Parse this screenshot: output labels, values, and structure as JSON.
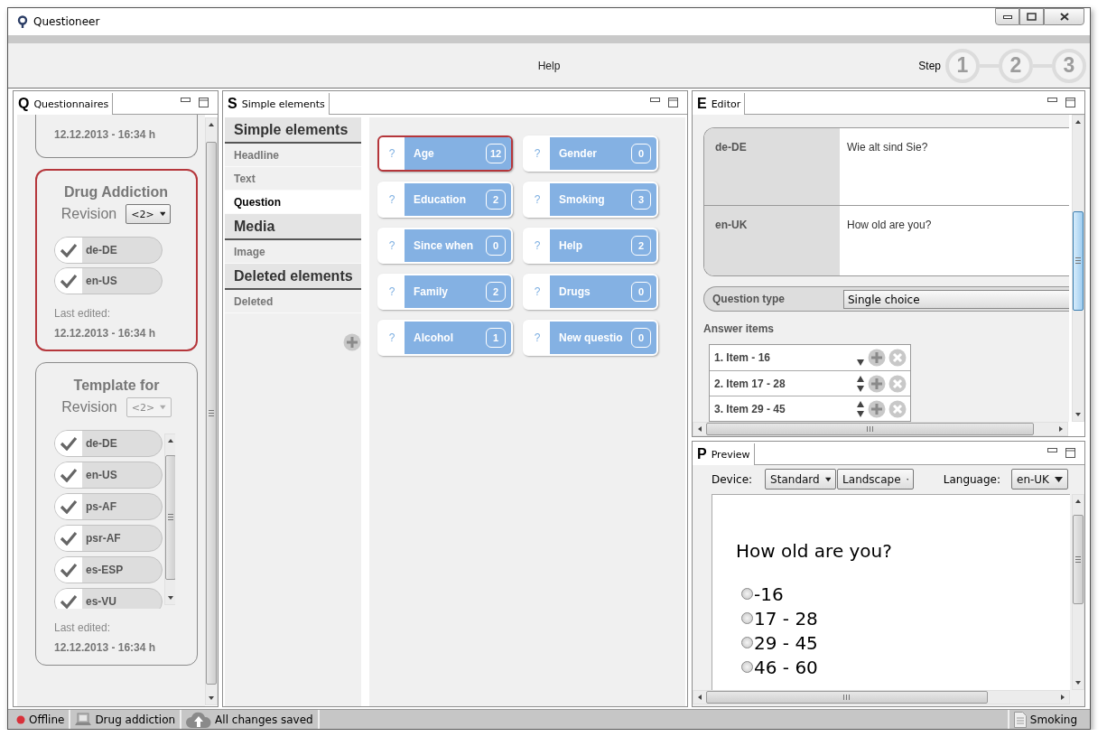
{
  "window": {
    "title": "Questioneer"
  },
  "toolbar": {
    "help": "Help",
    "step_label": "Step",
    "steps": [
      "1",
      "2",
      "3"
    ]
  },
  "questionnaires": {
    "tab_letter": "Q",
    "tab": "Questionnaires",
    "cards": [
      {
        "kind": "partial",
        "selected": false,
        "last_edited_date": "12.12.2013 - 16:34 h"
      },
      {
        "kind": "full",
        "selected": true,
        "title": "Drug Addiction",
        "revision_label": "Revision",
        "revision": "<2>",
        "revision_disabled": false,
        "languages": [
          {
            "code": "de-DE",
            "checked": true
          },
          {
            "code": "en-US",
            "checked": true
          }
        ],
        "last_edited_label": "Last edited:",
        "last_edited_date": "12.12.2013 - 16:34 h"
      },
      {
        "kind": "full",
        "selected": false,
        "title": "Template for",
        "revision_label": "Revision",
        "revision": "<2>",
        "revision_disabled": true,
        "languages": [
          {
            "code": "de-DE",
            "checked": true
          },
          {
            "code": "en-US",
            "checked": true
          },
          {
            "code": "ps-AF",
            "checked": true
          },
          {
            "code": "psr-AF",
            "checked": true
          },
          {
            "code": "es-ESP",
            "checked": true
          },
          {
            "code": "es-VU",
            "checked": true
          }
        ],
        "last_edited_label": "Last edited:",
        "last_edited_date": "12.12.2013 - 16:34 h"
      }
    ]
  },
  "elements": {
    "tab_letter": "S",
    "tab": "Simple elements",
    "categories": [
      {
        "kind": "header",
        "label": "Simple elements"
      },
      {
        "kind": "item",
        "label": "Headline",
        "selected": false
      },
      {
        "kind": "item",
        "label": "Text",
        "selected": false
      },
      {
        "kind": "item",
        "label": "Question",
        "selected": true
      },
      {
        "kind": "header",
        "label": "Media"
      },
      {
        "kind": "item",
        "label": "Image",
        "selected": false
      },
      {
        "kind": "header",
        "label": "Deleted elements"
      },
      {
        "kind": "item",
        "label": "Deleted",
        "selected": false
      }
    ],
    "cards": [
      {
        "mark": "?",
        "label": "Age",
        "count": "12",
        "selected": true
      },
      {
        "mark": "?",
        "label": "Gender",
        "count": "0",
        "selected": false
      },
      {
        "mark": "?",
        "label": "Education",
        "count": "2",
        "selected": false
      },
      {
        "mark": "?",
        "label": "Smoking",
        "count": "3",
        "selected": false
      },
      {
        "mark": "?",
        "label": "Since when",
        "count": "0",
        "selected": false
      },
      {
        "mark": "?",
        "label": "Help",
        "count": "2",
        "selected": false
      },
      {
        "mark": "?",
        "label": "Family",
        "count": "2",
        "selected": false
      },
      {
        "mark": "?",
        "label": "Drugs",
        "count": "0",
        "selected": false
      },
      {
        "mark": "?",
        "label": "Alcohol",
        "count": "1",
        "selected": false
      },
      {
        "mark": "?",
        "label": "New questio",
        "count": "0",
        "selected": false
      }
    ]
  },
  "editor": {
    "tab_letter": "E",
    "tab": "Editor",
    "translations": [
      {
        "language": "de-DE",
        "text": "Wie alt sind Sie?"
      },
      {
        "language": "en-UK",
        "text": "How old are you?"
      }
    ],
    "question_type_label": "Question type",
    "question_type": "Single choice",
    "answer_items_label": "Answer items",
    "answer_items": [
      {
        "label": "1. Item - 16",
        "can_move_up": false
      },
      {
        "label": "2. Item 17 - 28",
        "can_move_up": true
      },
      {
        "label": "3. Item 29 - 45",
        "can_move_up": true
      }
    ]
  },
  "preview": {
    "tab_letter": "P",
    "tab": "Preview",
    "device_label": "Device:",
    "device": "Standard",
    "orientation": "Landscape",
    "language_label": "Language:",
    "language": "en-UK",
    "question": "How old are you?",
    "options": [
      {
        "label": "-16",
        "selected": false
      },
      {
        "label": "17 - 28",
        "selected": false
      },
      {
        "label": "29 - 45",
        "selected": false
      },
      {
        "label": "46 - 60",
        "selected": false
      }
    ]
  },
  "status_bar": {
    "items": [
      {
        "kind": "offline",
        "label": "Offline"
      },
      {
        "kind": "computer",
        "label": "Drug addiction"
      },
      {
        "kind": "cloud",
        "label": "All changes saved"
      }
    ],
    "right": {
      "kind": "document",
      "label": "Smoking"
    }
  }
}
